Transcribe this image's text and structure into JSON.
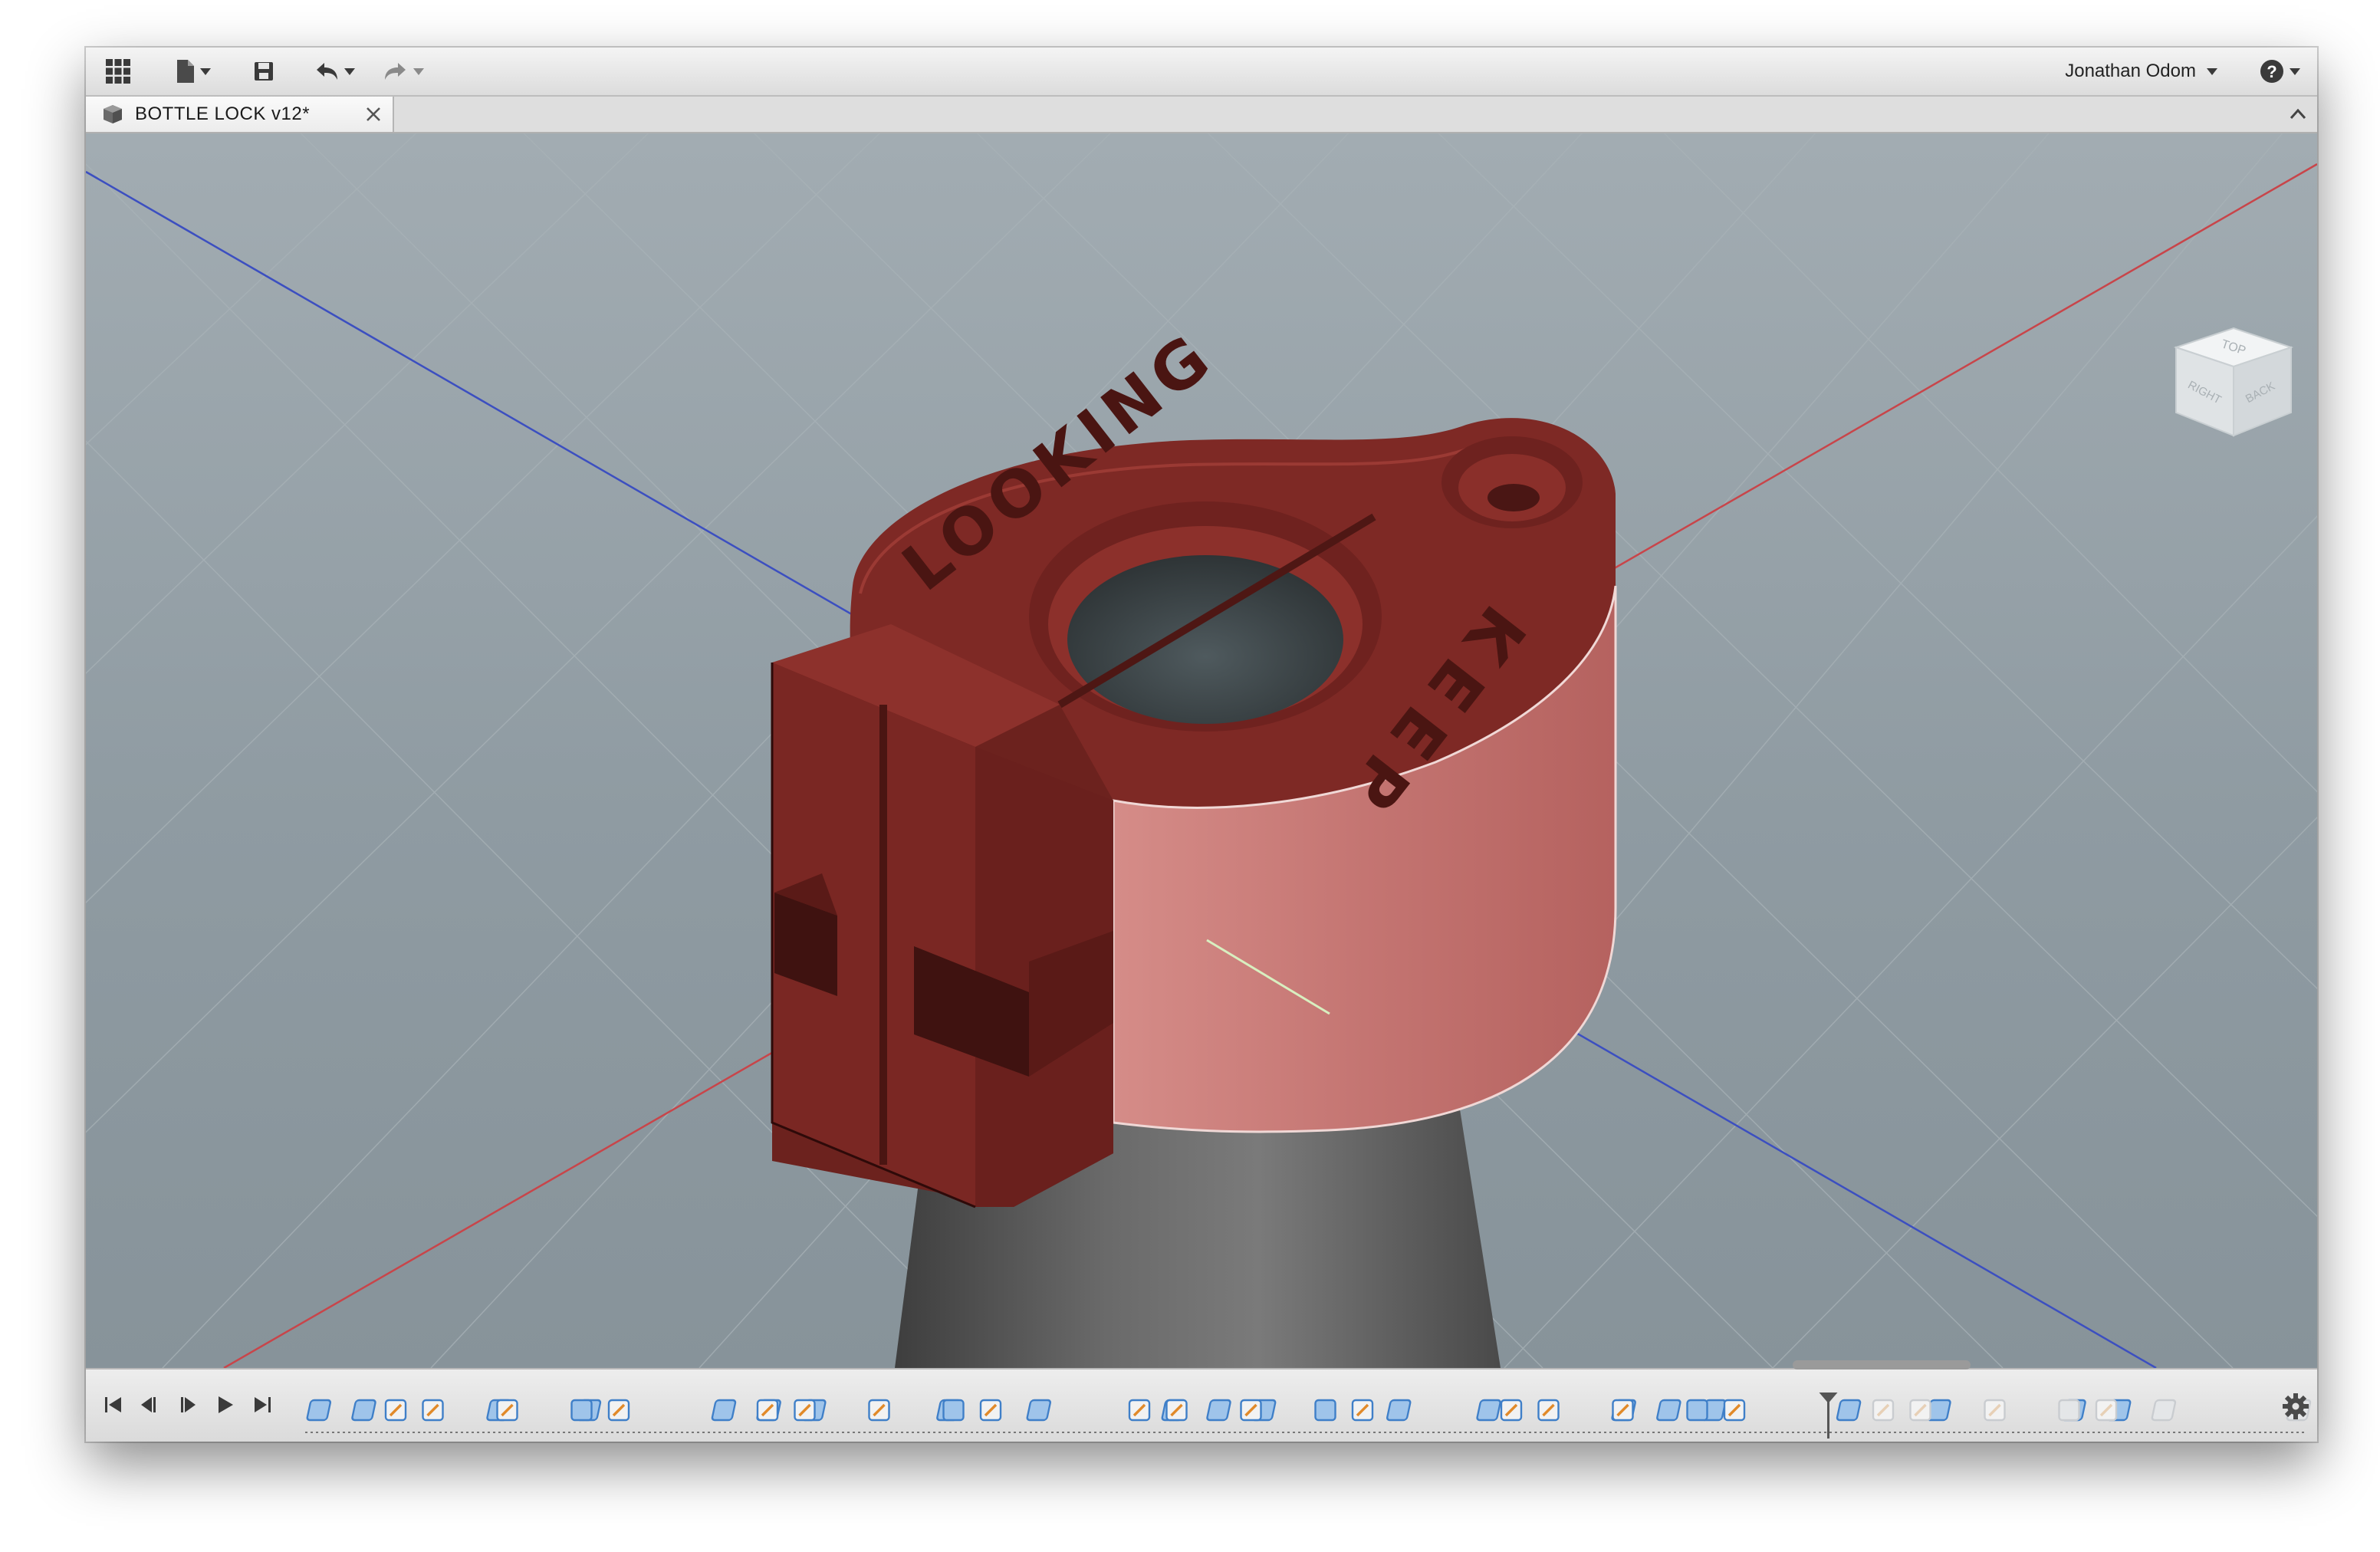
{
  "toolbar": {
    "grid_icon": "app-grid-icon",
    "file_icon": "file-icon",
    "save_icon": "save-icon",
    "undo_icon": "undo-icon",
    "redo_icon": "redo-icon",
    "user_name": "Jonathan Odom",
    "help_icon": "help-icon"
  },
  "tab": {
    "title": "BOTTLE LOCK v12*",
    "close_icon": "close-icon"
  },
  "model": {
    "engraving_left": "LOOKING",
    "engraving_right": "KEEP",
    "body_color": "#7a2622",
    "selected_face_color": "#c26f6b",
    "bottle_color": "#5a5a5a"
  },
  "viewcube": {
    "top": "TOP",
    "right": "RIGHT",
    "back": "BACK"
  },
  "timeline": {
    "controls": [
      "first-icon",
      "previous-icon",
      "play-step-icon",
      "play-icon",
      "last-icon"
    ],
    "feature_count": 51,
    "active_count": 41,
    "settings_icon": "gear-icon"
  },
  "colors": {
    "axis_x": "#c8454a",
    "axis_y": "#3c4fc0",
    "grid": "#a9b3b8",
    "sketch_line": "#d8efc0"
  }
}
